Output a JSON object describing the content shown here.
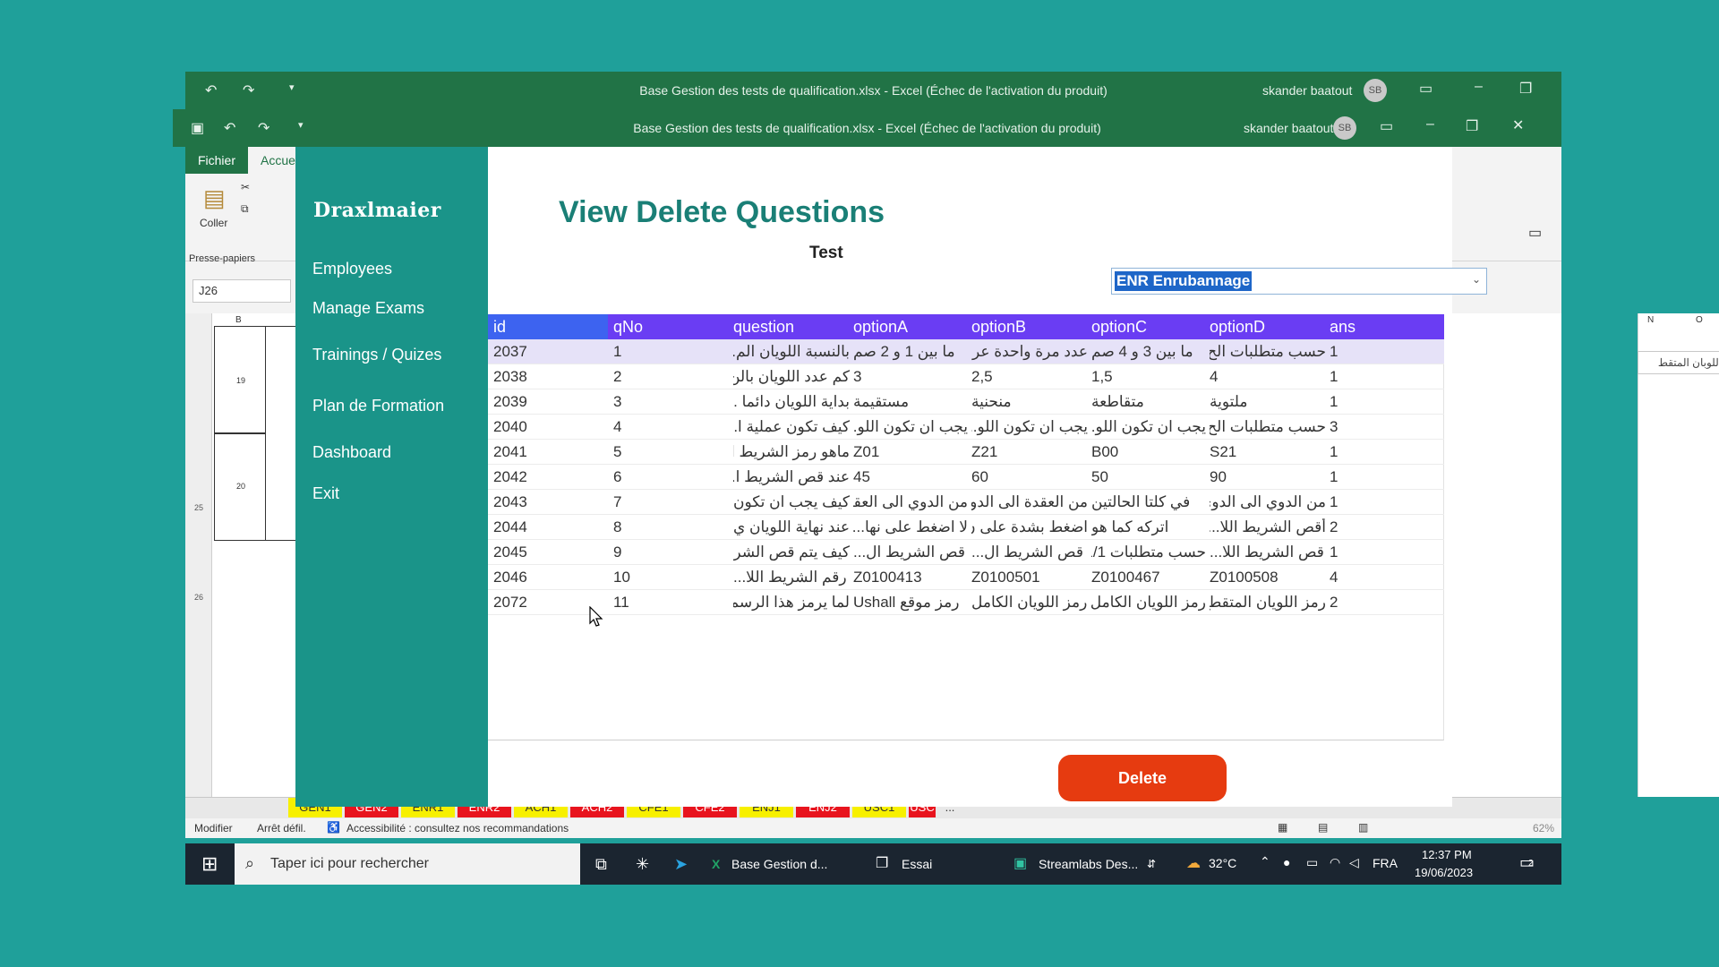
{
  "excel": {
    "title": "Base Gestion des tests de qualification.xlsx  -  Excel (Échec de l'activation du produit)",
    "user": "skander baatout",
    "avatar": "SB",
    "tab_file": "Fichier",
    "tab_home": "Accue",
    "paste_label": "Coller",
    "clipboard_label": "Presse-papiers",
    "name_box": "J26",
    "right_combo": "رمزاللوبان المتقط",
    "col_b": "B",
    "col_n": "N",
    "col_o": "O",
    "row_labels": [
      "19",
      "20"
    ],
    "sheet_tabs": [
      "GEN1",
      "GEN2",
      "ENR1",
      "ENR2",
      "ACH1",
      "ACH2",
      "CFE1",
      "CFE2",
      "ENJ1",
      "ENJ2",
      "USC1",
      "USC",
      "..."
    ],
    "status": {
      "mode": "Modifier",
      "scroll": "Arrêt défil.",
      "accessibility": "Accessibilité : consultez nos recommandations",
      "zoom": "62%"
    }
  },
  "app": {
    "brand": "Draxlmaier",
    "nav": [
      "Employees",
      "Manage Exams",
      "Trainings / Quizes",
      "Plan de Formation",
      "Dashboard",
      "Exit"
    ],
    "title": "View Delete Questions",
    "test_label": "Test",
    "test_value": "ENR Enrubannage",
    "columns": [
      "id",
      "qNo",
      "question",
      "optionA",
      "optionB",
      "optionC",
      "optionD",
      "ans"
    ],
    "rows": [
      [
        "2037",
        "1",
        "بالنسبة اللويان الم...",
        "ما بين 1 و 2 صم",
        "عدد مرة واحدة عر...",
        "ما بين 3 و 4 صم",
        "حسب متطلبات الح...",
        "1"
      ],
      [
        "2038",
        "2",
        "كم عدد اللويان بالن...",
        "3",
        "2,5",
        "1,5",
        "4",
        "1"
      ],
      [
        "2039",
        "3",
        "بداية اللويان دائما ...",
        "مستقيمة",
        "منحنية",
        "متقاطعة",
        "ملتوية",
        "1"
      ],
      [
        "2040",
        "4",
        "كيف تكون عملية ا...",
        "يجب ان تكون اللو...",
        "يجب ان تكون اللو...",
        "يجب ان تكون اللو...",
        "حسب متطلبات الح...",
        "3"
      ],
      [
        "2041",
        "5",
        "ماهو رمز الشريط ا...",
        "Z01",
        "Z21",
        "B00",
        "S21",
        "1"
      ],
      [
        "2042",
        "6",
        "عند قص الشريط ا...",
        "45",
        "60",
        "50",
        "90",
        "1"
      ],
      [
        "2043",
        "7",
        "كيف يجب ان تكون...",
        "من الدوي الى العقدة",
        "من العقدة الى الدوي",
        "في كلتا الحالتين",
        "من الدوي الى الدوي",
        "1"
      ],
      [
        "2044",
        "8",
        "عند نهاية اللويان ي...",
        "لا اضغط على نها...",
        "اضغط بشدة على ن...",
        "اتركه كما هو",
        "أقص الشريط اللا...",
        "2"
      ],
      [
        "2045",
        "9",
        "كيف يتم قص الشر...",
        "قص الشريط ال...",
        "قص الشريط ال...",
        "حسب متطلبات 1/1",
        "قص الشريط اللا...",
        "1"
      ],
      [
        "2046",
        "10",
        "رقم الشريط اللا...",
        "Z0100413",
        "Z0100501",
        "Z0100467",
        "Z0100508",
        "4"
      ],
      [
        "2072",
        "11",
        "لما يرمز هذا الرسم؟",
        "رمز موقع Ushall",
        "رمز اللويان الكامل",
        "رمز اللويان الكامل ...",
        "رمز اللويان المتقطع",
        "2"
      ]
    ],
    "delete_label": "Delete"
  },
  "taskbar": {
    "search_placeholder": "Taper ici pour rechercher",
    "apps": [
      "Base Gestion d...",
      "Essai",
      "Streamlabs Des..."
    ],
    "temperature": "32°C",
    "language": "FRA",
    "time": "12:37 PM",
    "date": "19/06/2023",
    "notifications": "2"
  },
  "colors": {
    "background": "#1fa09a",
    "excel_green": "#217346",
    "sidebar": "#1a9489",
    "title": "#1a7f76",
    "grid_header": "#6a3df3",
    "grid_header_id": "#3d63f0",
    "delete": "#e63b10"
  }
}
